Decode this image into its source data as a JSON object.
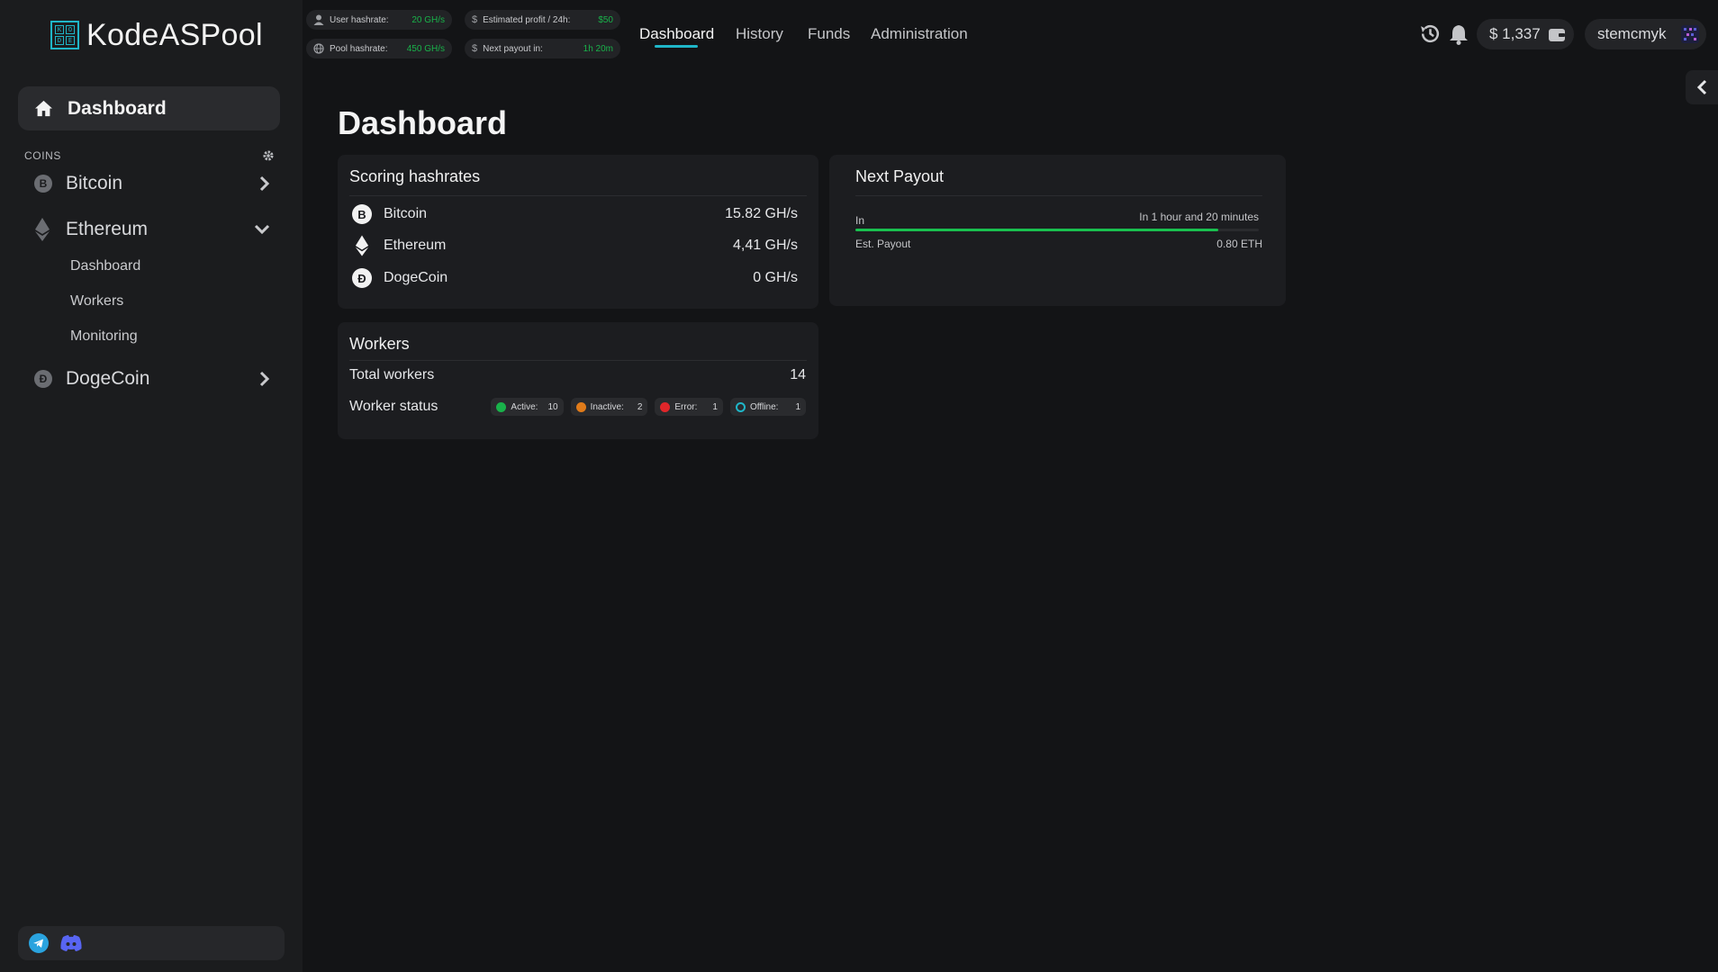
{
  "brand": {
    "name": "KodeASPool",
    "mark_letters": [
      "K",
      "O",
      "D",
      "E"
    ],
    "accent": "#1fb6c8"
  },
  "topbar": {
    "stats": [
      {
        "label": "User hashrate:",
        "value": "20 GH/s",
        "icon": "user-icon"
      },
      {
        "label": "Pool hashrate:",
        "value": "450 GH/s",
        "icon": "globe-icon"
      },
      {
        "label": "Estimated profit / 24h:",
        "value": "$50",
        "icon": "dollar-icon"
      },
      {
        "label": "Next payout in:",
        "value": "1h 20m",
        "icon": "dollar-icon"
      }
    ],
    "nav": [
      "Dashboard",
      "History",
      "Funds",
      "Administration"
    ],
    "active_nav": "Dashboard",
    "balance": "$ 1,337",
    "username": "stemcmyk"
  },
  "sidebar": {
    "dashboard_label": "Dashboard",
    "coins_heading": "COINS",
    "coins": [
      {
        "name": "Bitcoin",
        "symbol": "B"
      },
      {
        "name": "Ethereum",
        "symbol": "◆",
        "expanded": true,
        "sub_items": [
          "Dashboard",
          "Workers",
          "Monitoring"
        ]
      },
      {
        "name": "DogeCoin",
        "symbol": "Đ"
      }
    ]
  },
  "main": {
    "title": "Dashboard",
    "scoring": {
      "title": "Scoring hashrates",
      "rows": [
        {
          "coin": "Bitcoin",
          "symbol": "B",
          "value": "15.82 GH/s"
        },
        {
          "coin": "Ethereum",
          "symbol": "◆",
          "value": "4,41 GH/s"
        },
        {
          "coin": "DogeCoin",
          "symbol": "Đ",
          "value": "0 GH/s"
        }
      ]
    },
    "next_payout": {
      "title": "Next Payout",
      "in_label": "In",
      "in_value": "In 1 hour and 20 minutes",
      "progress": 0.9,
      "est_label": "Est. Payout",
      "est_value": "0.80 ETH",
      "progress_color": "#19c04f"
    },
    "workers": {
      "title": "Workers",
      "total_label": "Total workers",
      "total_value": "14",
      "status_label": "Worker status",
      "statuses": [
        {
          "label": "Active:",
          "count": "10",
          "color": "#19b24a"
        },
        {
          "label": "Inactive:",
          "count": "2",
          "color": "#e07b1a"
        },
        {
          "label": "Error:",
          "count": "1",
          "color": "#e0262a"
        },
        {
          "label": "Offline:",
          "count": "1",
          "color": "#1fb6c8"
        }
      ]
    }
  }
}
